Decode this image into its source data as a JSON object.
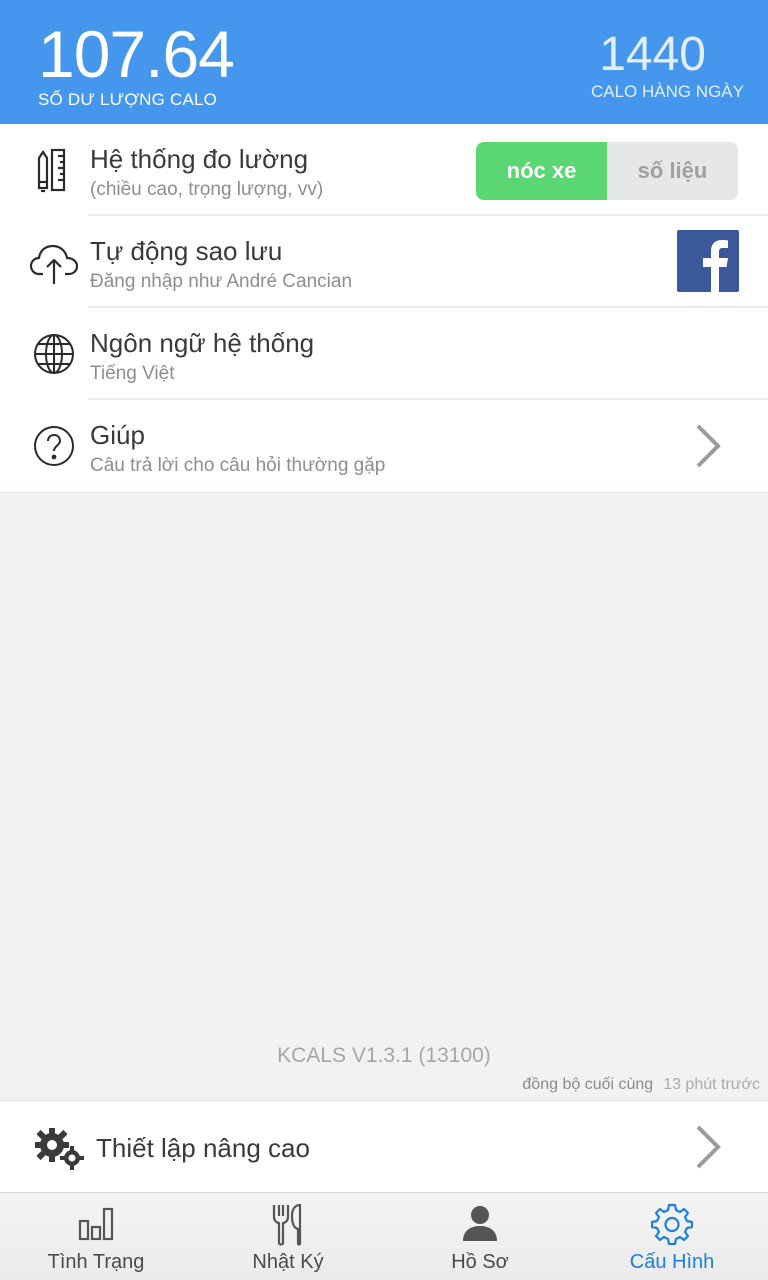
{
  "header": {
    "balance_value": "107.64",
    "balance_label": "SỐ DƯ LƯỢNG CALO",
    "daily_value": "1440",
    "daily_label": "CALO HÀNG NGÀY"
  },
  "settings": [
    {
      "title": "Hệ thống đo lường",
      "subtitle": "(chiều cao, trọng lượng, vv)",
      "icon": "ruler-pencil-icon",
      "toggle": {
        "option_a": "nóc xe",
        "option_b": "số liệu",
        "selected": "nóc xe"
      }
    },
    {
      "title": "Tự động sao lưu",
      "subtitle": "Đăng nhập như André Cancian",
      "icon": "cloud-upload-icon",
      "accessory": "facebook-icon"
    },
    {
      "title": "Ngôn ngữ hệ thống",
      "subtitle": "Tiếng Việt",
      "icon": "globe-icon"
    },
    {
      "title": "Giúp",
      "subtitle": "Câu trả lời cho câu hỏi thường gặp",
      "icon": "help-circle-icon",
      "accessory": "chevron-right-icon"
    }
  ],
  "footer": {
    "version": "KCALS V1.3.1 (13100)",
    "sync_label": "đồng bộ cuối cùng",
    "sync_time": "13 phút trước"
  },
  "advanced": {
    "title": "Thiết lập nâng cao",
    "icon": "gears-icon"
  },
  "nav": {
    "tabs": [
      {
        "label": "Tình Trạng",
        "icon": "bar-chart-icon"
      },
      {
        "label": "Nhật Ký",
        "icon": "fork-knife-icon"
      },
      {
        "label": "Hồ Sơ",
        "icon": "person-icon"
      },
      {
        "label": "Cấu Hình",
        "icon": "gear-icon"
      }
    ],
    "active_index": 3
  },
  "colors": {
    "header_bg": "#4597ee",
    "toggle_on": "#5ad672",
    "facebook": "#3b5998",
    "active_tab": "#1a7fe0"
  }
}
